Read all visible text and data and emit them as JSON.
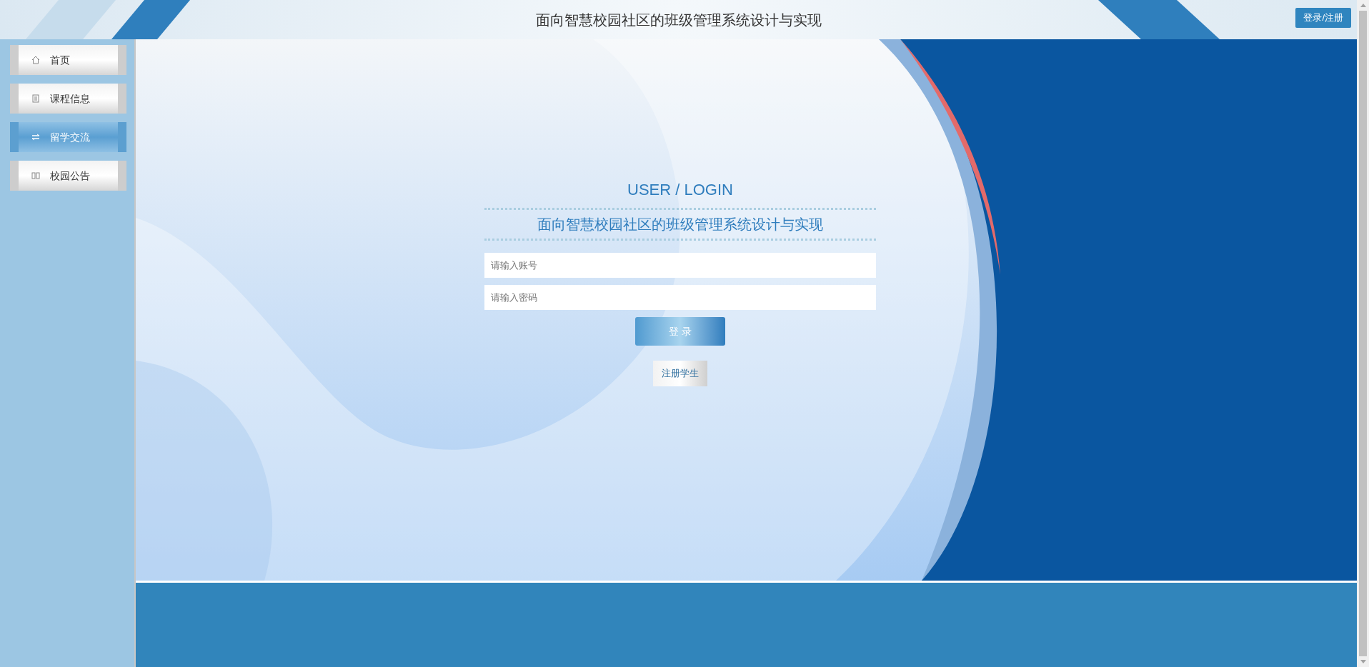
{
  "header": {
    "title": "面向智慧校园社区的班级管理系统设计与实现",
    "login_register_button": "登录/注册"
  },
  "sidebar": {
    "items": [
      {
        "label": "首页",
        "selected": false
      },
      {
        "label": "课程信息",
        "selected": false
      },
      {
        "label": "留学交流",
        "selected": true
      },
      {
        "label": "校园公告",
        "selected": false
      }
    ]
  },
  "login": {
    "heading": "USER / LOGIN",
    "subtitle": "面向智慧校园社区的班级管理系统设计与实现",
    "account_field": {
      "placeholder": "请输入账号"
    },
    "password_field": {
      "placeholder": "请输入密码"
    },
    "login_button": "登 录",
    "register_button": "注册学生"
  }
}
